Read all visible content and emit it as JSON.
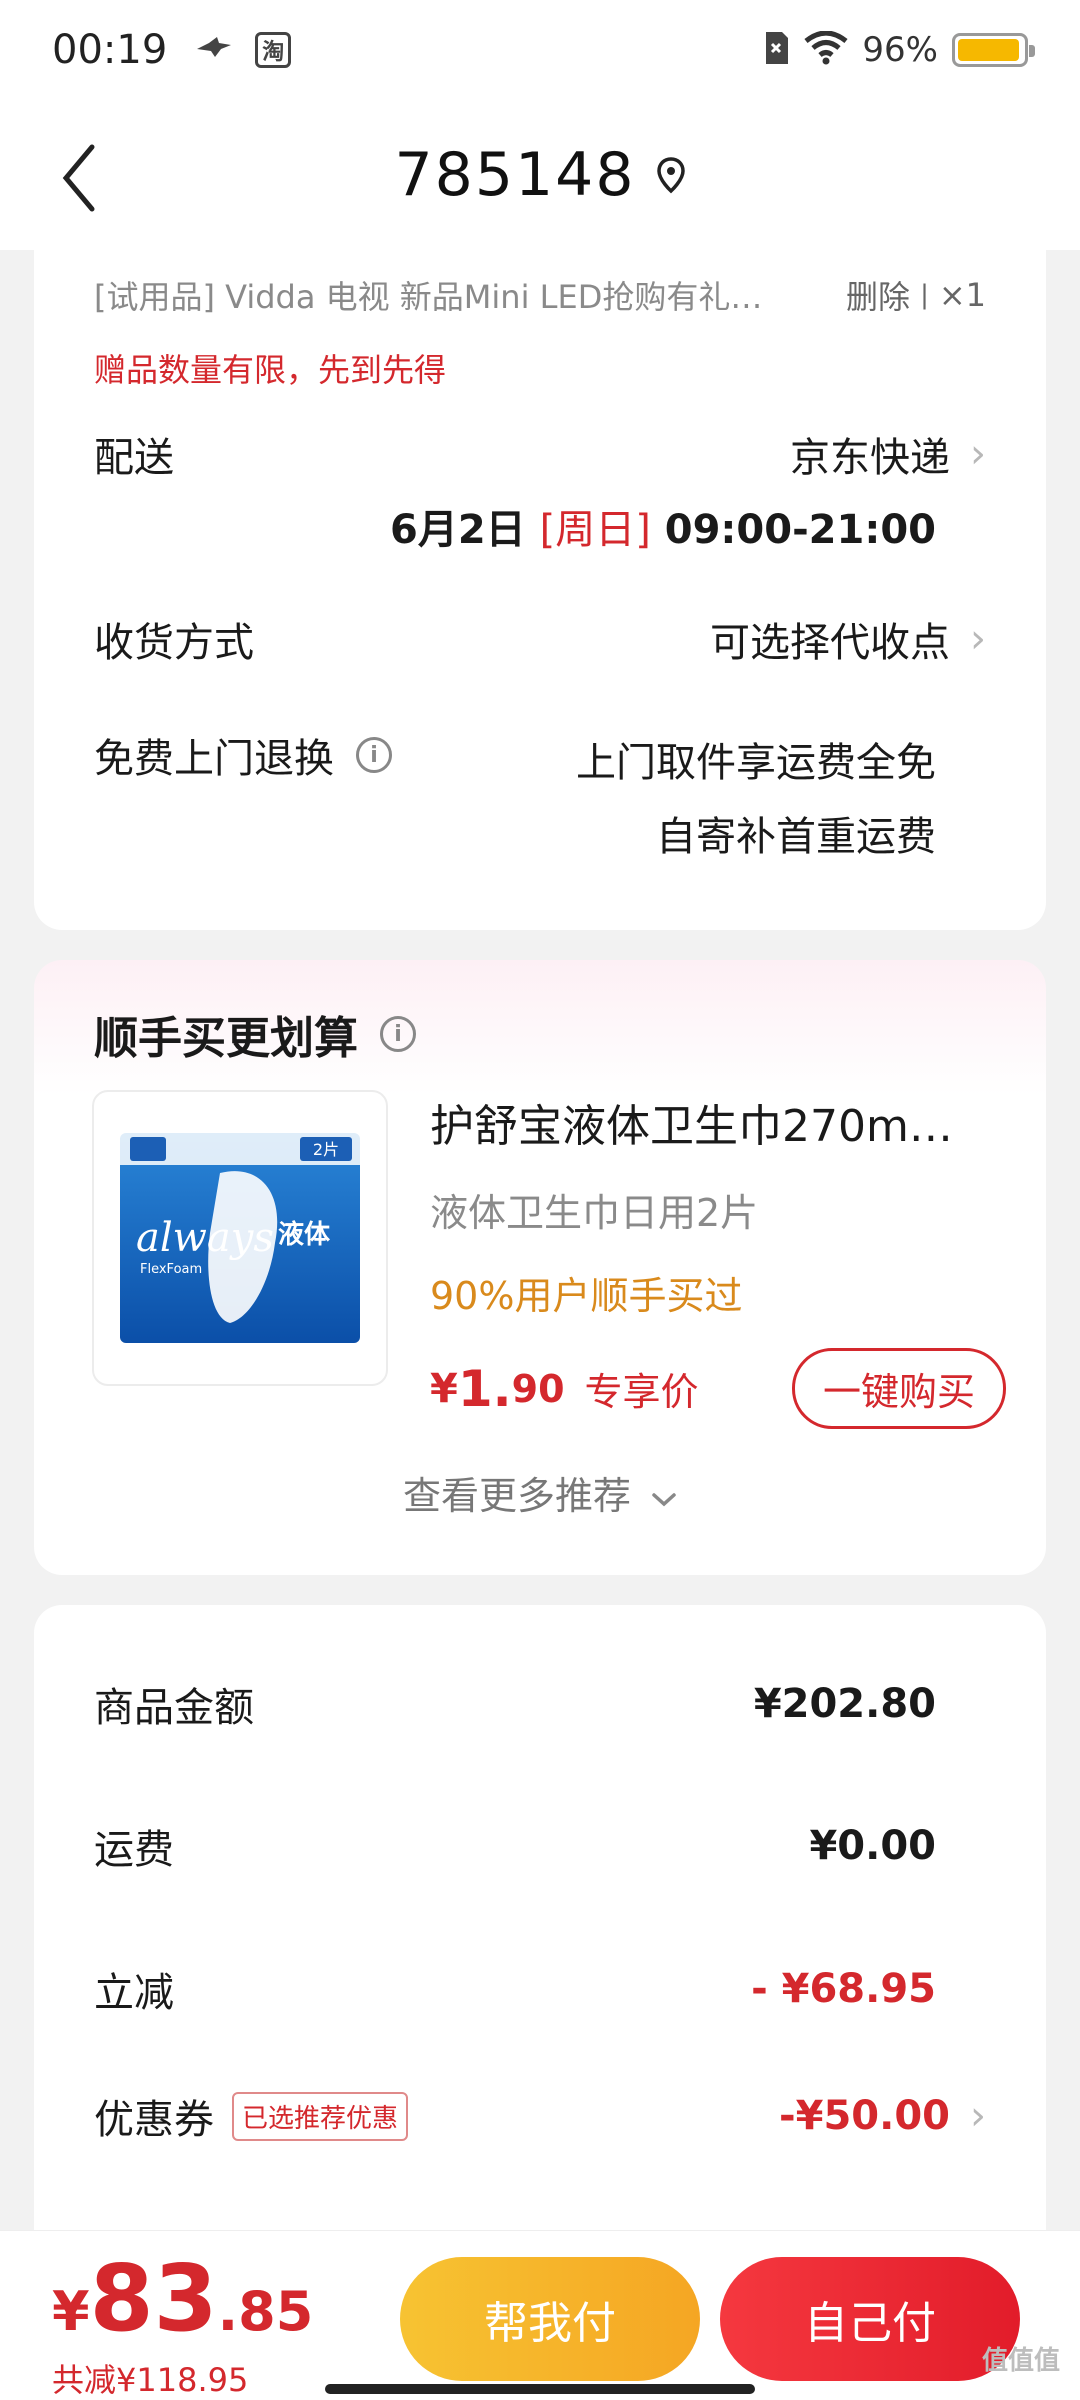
{
  "status_bar": {
    "time": "00:19",
    "battery_text": "96%",
    "battery_level": 0.96,
    "icons": [
      "bird-icon",
      "taobao-icon",
      "sim-icon",
      "wifi-icon",
      "battery-icon"
    ],
    "taobao_glyph": "淘"
  },
  "header": {
    "title": "785148",
    "back_icon": "chevron-left-icon",
    "location_icon": "location-pin-icon"
  },
  "gift": {
    "text": "[试用品]   Vidda 电视 新品Mini LED抢购有礼…",
    "delete_label": "删除",
    "separator": "|",
    "qty": "×1",
    "note": "赠品数量有限，先到先得"
  },
  "delivery": {
    "label": "配送",
    "carrier": "京东快递",
    "date": "6月2日",
    "weekday": "[周日]",
    "time_range": "09:00-21:00"
  },
  "receive": {
    "label": "收货方式",
    "value": "可选择代收点"
  },
  "return": {
    "label": "免费上门退换",
    "line1": "上门取件享运费全免",
    "line2": "自寄补首重运费"
  },
  "promo": {
    "title": "顺手买更划算",
    "product_name": "护舒宝液体卫生巾270m…",
    "spec": "液体卫生巾日用2片",
    "social": "90%用户顺手买过",
    "price_currency": "¥",
    "price_int": "1.",
    "price_dec": "90",
    "price_tag": "专享价",
    "buy_label": "一键购买",
    "more_label": "查看更多推荐",
    "image_brand": "always",
    "image_sub": "FlexFoam",
    "image_cn": "液体",
    "image_count": "2片"
  },
  "summary": {
    "goods_label": "商品金额",
    "goods_value": "¥202.80",
    "shipping_label": "运费",
    "shipping_value": "¥0.00",
    "discount_label": "立减",
    "discount_value": "- ¥68.95",
    "coupon_label": "优惠券",
    "coupon_badge": "已选推荐优惠",
    "coupon_value": "-¥50.00"
  },
  "bottom": {
    "total_currency": "¥",
    "total_int": "83",
    "total_dec": ".85",
    "saved": "共减¥118.95",
    "help_pay": "帮我付",
    "self_pay": "自己付"
  },
  "watermark": "值值值",
  "colors": {
    "accent_red": "#d4282d",
    "orange_text": "#d98a1c",
    "help_pay_yellow": "#f7c332",
    "self_pay_red": "#e21c2a",
    "battery_yellow": "#f6b800"
  }
}
